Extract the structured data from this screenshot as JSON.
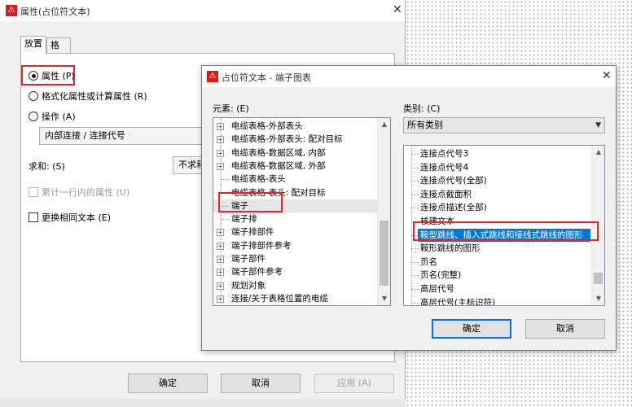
{
  "back_dialog": {
    "title": "属性(占位符文本)",
    "tabs": [
      "放置",
      "格式"
    ],
    "radio_attribute": "属性 (P)",
    "radio_formatted": "格式化属性或计算属性 (R)",
    "radio_action": "操作 (A)",
    "action_value": "内部连接 / 连接代号",
    "sum_label": "求和: (S)",
    "sum_value": "不求和",
    "accumulate_label": "累计一行内的属性 (U)",
    "replace_label": "更换相同文本 (E)",
    "ok": "确定",
    "cancel": "取消",
    "apply": "应用 (A)"
  },
  "front_dialog": {
    "title": "占位符文本 - 端子图表",
    "elements_label": "元素: (E)",
    "category_label": "类别: (C)",
    "category_value": "所有类别",
    "elements": [
      {
        "label": "电缆表格-外部表头",
        "expandable": true
      },
      {
        "label": "电缆表格-外部表头: 配对目标",
        "expandable": true
      },
      {
        "label": "电缆表格-数据区域, 内部",
        "expandable": true
      },
      {
        "label": "电缆表格-数据区域, 外部",
        "expandable": true
      },
      {
        "label": "电缆表格-表头",
        "expandable": false
      },
      {
        "label": "电缆表格-表头: 配对目标",
        "expandable": false
      },
      {
        "label": "端子",
        "expandable": false
      },
      {
        "label": "端子排",
        "expandable": false
      },
      {
        "label": "端子排部件",
        "expandable": true
      },
      {
        "label": "端子排部件参考",
        "expandable": true
      },
      {
        "label": "端子部件",
        "expandable": true
      },
      {
        "label": "端子部件参考",
        "expandable": true
      },
      {
        "label": "规划对象",
        "expandable": true
      },
      {
        "label": "连接/关于表格位置的电缆",
        "expandable": true
      }
    ],
    "categories": [
      "连接点代号3",
      "连接点代号4",
      "连接点代号(全部)",
      "连接点截面积",
      "连接点描述(全部)",
      "核建文本",
      "鞍型跳线、插入式跳线和接线式跳线的图形",
      "鞍形跳线的图形",
      "页名",
      "页名(完整)",
      "高层代号",
      "高层代号(主标识符)"
    ],
    "ok": "确定",
    "cancel": "取消"
  }
}
